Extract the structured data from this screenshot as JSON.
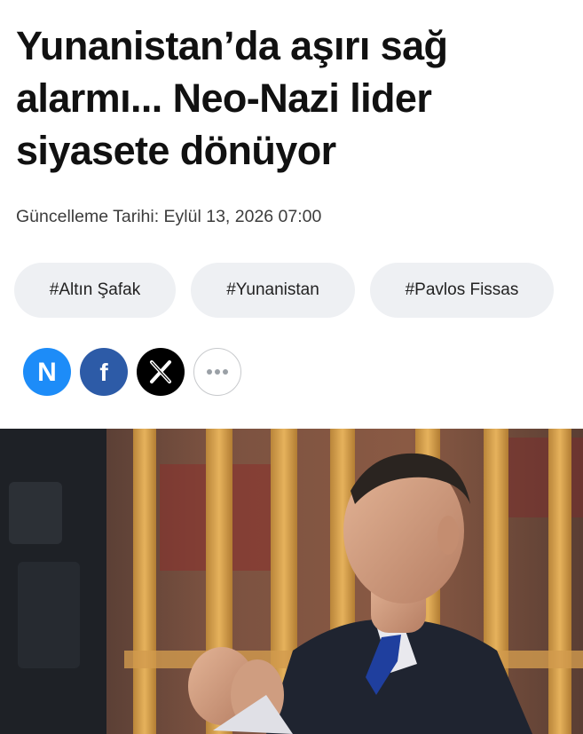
{
  "article": {
    "title_lines": [
      "Yunanistan’da aşırı sağ",
      "alarmı... Neo-Nazi lider",
      "siyasete dönüyor"
    ],
    "updated": "Güncelleme Tarihi: Eylül 13, 2026 07:00"
  },
  "tags": [
    "#Altın Şafak",
    "#Yunanistan",
    "#Pavlos Fissas"
  ],
  "share": {
    "items": [
      {
        "icon": "n-news-icon",
        "glyph": "N",
        "color": "#1d8cf8"
      },
      {
        "icon": "facebook-icon",
        "glyph": "f",
        "color": "#2d5ba7"
      },
      {
        "icon": "x-twitter-icon",
        "glyph": "X",
        "color": "#000000"
      },
      {
        "icon": "more-icon",
        "glyph": "•••",
        "color": "#9aa0a6"
      }
    ]
  },
  "hero_image": {
    "icon": "article-photo",
    "colors": {
      "accent_tie": "#1f3f9e",
      "background": "#6f4b3a",
      "bars": "#d8a24a"
    }
  }
}
